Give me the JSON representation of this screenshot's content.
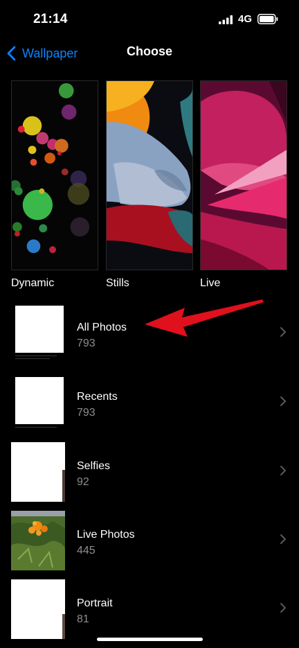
{
  "status": {
    "time": "21:14",
    "network": "4G"
  },
  "nav": {
    "back_label": "Wallpaper",
    "title": "Choose"
  },
  "categories": [
    {
      "label": "Dynamic"
    },
    {
      "label": "Stills"
    },
    {
      "label": "Live"
    }
  ],
  "albums": [
    {
      "name": "All Photos",
      "count": "793"
    },
    {
      "name": "Recents",
      "count": "793"
    },
    {
      "name": "Selfies",
      "count": "92"
    },
    {
      "name": "Live Photos",
      "count": "445"
    },
    {
      "name": "Portrait",
      "count": "81"
    }
  ],
  "colors": {
    "accent": "#0a84ff",
    "background": "#000000",
    "secondary_text": "#8e8e93",
    "annotation_arrow": "#e0101c"
  }
}
